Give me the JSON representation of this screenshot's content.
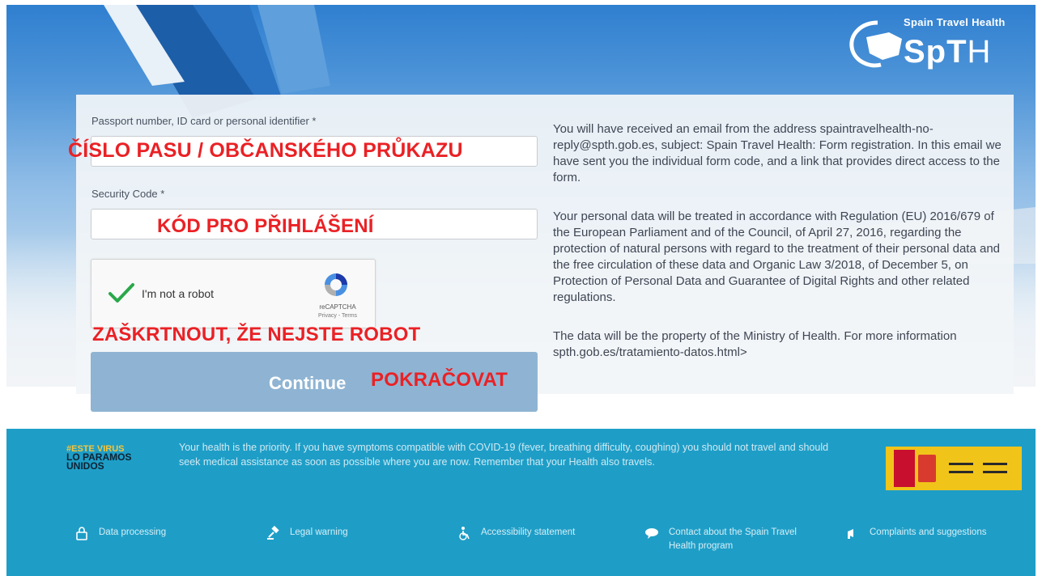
{
  "brand": {
    "top_text": "Spain Travel Health",
    "main_text": "SpT",
    "main_text_light": "H"
  },
  "form": {
    "passport_label": "Passport number, ID card or personal identifier *",
    "security_label": "Security Code *",
    "passport_value": "",
    "security_value": "",
    "captcha_label": "I'm not a robot",
    "captcha_brand": "reCAPTCHA",
    "captcha_terms": "Privacy - Terms",
    "continue_label": "Continue"
  },
  "annotations": {
    "passport": "ČÍSLO PASU / OBČANSKÉHO PRŮKAZU",
    "security": "KÓD PRO PŘIHLÁŠENÍ",
    "captcha": "ZAŠKRTNOUT, ŽE NEJSTE ROBOT",
    "continue": "POKRAČOVAT"
  },
  "info": {
    "para1": "You will have received an email from the address spaintravelhealth-no-reply@spth.gob.es, subject: Spain Travel Health: Form registration. In this email we have sent you the individual form code, and a link that provides direct access to the form.",
    "para2": "Your personal data will be treated in accordance with Regulation (EU) 2016/679 of the European Parliament and of the Council, of April 27, 2016, regarding the protection of natural persons with regard to the treatment of their personal data and the free circulation of these data and Organic Law 3/2018, of December 5, on Protection of Personal Data and Guarantee of Digital Rights and other related regulations.",
    "para3": "The data will be the property of the Ministry of Health. For more information spth.gob.es/tratamiento-datos.html>"
  },
  "footer": {
    "campaign_line1": "#ESTE VIRUS",
    "campaign_line2": "LO PARAMOS UNIDOS",
    "message": "Your health is the priority. If you have symptoms compatible with COVID-19 (fever, breathing difficulty, coughing) you should not travel and should seek medical assistance as soon as possible where you are now. Remember that your Health also travels.",
    "links": {
      "data_processing": "Data processing",
      "legal_warning": "Legal warning",
      "accessibility": "Accessibility statement",
      "contact": "Contact about the Spain Travel Health program",
      "complaints": "Complaints and suggestions"
    }
  },
  "colors": {
    "annotation_red": "#ea2125",
    "button_blue": "#8fb4d3",
    "footer_teal": "#1e9ec7"
  },
  "icons": {
    "check": "check-icon",
    "recaptcha": "recaptcha-icon",
    "lock": "lock-icon",
    "gavel": "gavel-icon",
    "accessibility": "wheelchair-icon",
    "contact": "chat-icon",
    "complaints": "megaphone-icon"
  }
}
